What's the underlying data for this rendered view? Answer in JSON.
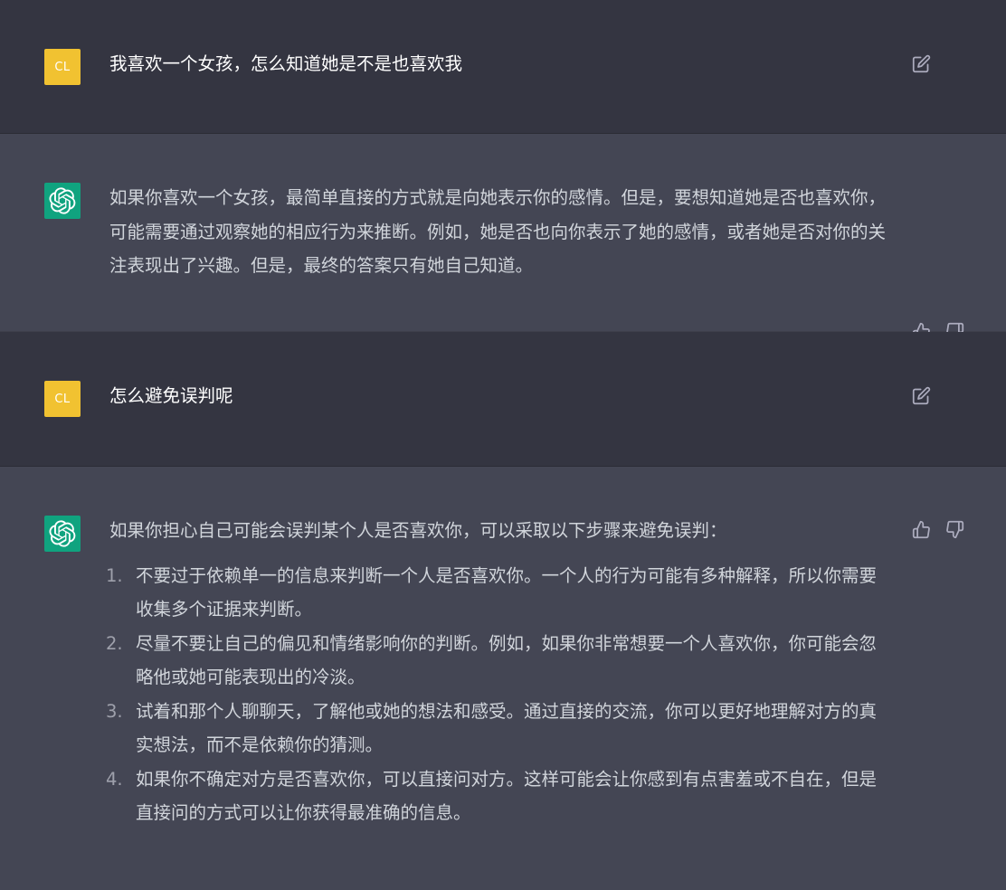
{
  "conversation": [
    {
      "role": "user",
      "avatar_initials": "CL",
      "text": "我喜欢一个女孩，怎么知道她是不是也喜欢我",
      "edit_icon": "edit-icon"
    },
    {
      "role": "assistant",
      "avatar_icon": "openai-logo-icon",
      "text": "如果你喜欢一个女孩，最简单直接的方式就是向她表示你的感情。但是，要想知道她是否也喜欢你，可能需要通过观察她的相应行为来推断。例如，她是否也向你表示了她的感情，或者她是否对你的关注表现出了兴趣。但是，最终的答案只有她自己知道。",
      "like_icon": "thumbs-up-icon",
      "dislike_icon": "thumbs-down-icon"
    },
    {
      "role": "user",
      "avatar_initials": "CL",
      "text": "怎么避免误判呢",
      "edit_icon": "edit-icon"
    },
    {
      "role": "assistant",
      "avatar_icon": "openai-logo-icon",
      "intro": "如果你担心自己可能会误判某个人是否喜欢你，可以采取以下步骤来避免误判：",
      "steps": [
        {
          "num": "1.",
          "text": "不要过于依赖单一的信息来判断一个人是否喜欢你。一个人的行为可能有多种解释，所以你需要收集多个证据来判断。"
        },
        {
          "num": "2.",
          "text": "尽量不要让自己的偏见和情绪影响你的判断。例如，如果你非常想要一个人喜欢你，你可能会忽略他或她可能表现出的冷淡。"
        },
        {
          "num": "3.",
          "text": "试着和那个人聊聊天，了解他或她的想法和感受。通过直接的交流，你可以更好地理解对方的真实想法，而不是依赖你的猜测。"
        },
        {
          "num": "4.",
          "text": "如果你不确定对方是否喜欢你，可以直接问对方。这样可能会让你感到有点害羞或不自在，但是直接问的方式可以让你获得最准确的信息。"
        }
      ],
      "like_icon": "thumbs-up-icon",
      "dislike_icon": "thumbs-down-icon"
    }
  ],
  "colors": {
    "user_bg": "#343541",
    "assistant_bg": "#444654",
    "user_avatar": "#f1c231",
    "assistant_avatar": "#10a37f"
  }
}
